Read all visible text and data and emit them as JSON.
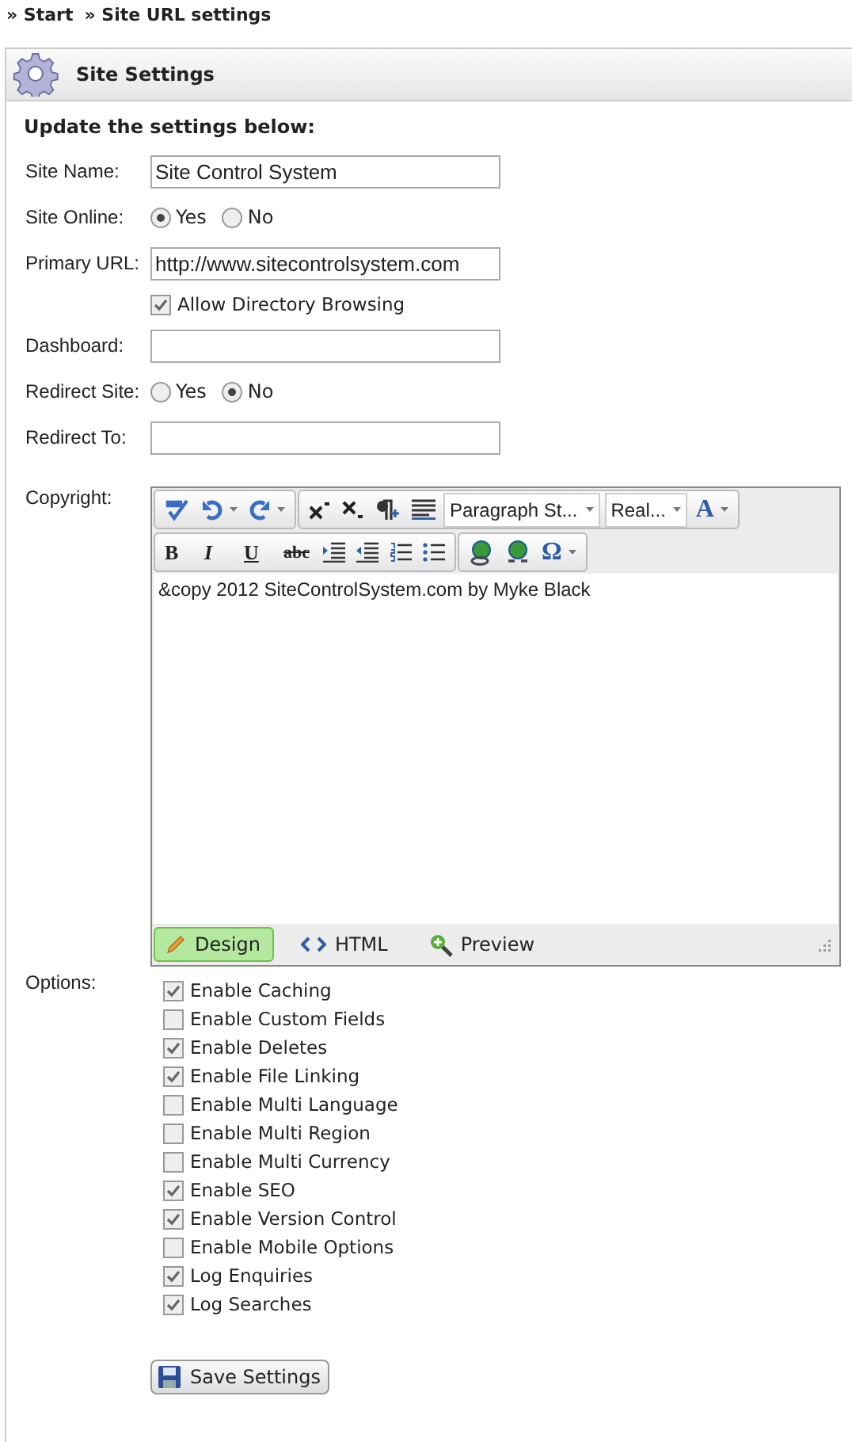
{
  "breadcrumb": [
    {
      "label": "» Start"
    },
    {
      "label": "» Site URL settings"
    }
  ],
  "panel": {
    "title": "Site Settings",
    "intro": "Update the settings below:"
  },
  "fields": [
    {
      "kind": "text",
      "label": "Site Name:",
      "value": "Site Control System"
    },
    {
      "kind": "radio",
      "label": "Site Online:",
      "options": [
        {
          "label": "Yes",
          "selected": true
        },
        {
          "label": "No",
          "selected": false
        }
      ]
    },
    {
      "kind": "text",
      "label": "Primary URL:",
      "value": "http://www.sitecontrolsystem.com"
    },
    {
      "kind": "checkbox",
      "label": "Allow Directory Browsing",
      "checked": true
    },
    {
      "kind": "text",
      "label": "Dashboard:"
    },
    {
      "kind": "radio",
      "label": "Redirect Site:",
      "options": [
        {
          "label": "Yes",
          "selected": false
        },
        {
          "label": "No",
          "selected": true
        }
      ]
    },
    {
      "kind": "text",
      "label": "Redirect To:"
    }
  ],
  "copyright": {
    "label": "Copyright:",
    "paragraph_style": "Paragraph St...",
    "font": "Real...",
    "font_color": "A",
    "format_buttons": [
      "B",
      "I",
      "U",
      "abc"
    ],
    "special_char": "Ω",
    "content": "&copy 2012 SiteControlSystem.com by Myke Black",
    "modes": [
      {
        "label": "Design",
        "selected": true
      },
      {
        "label": "HTML",
        "selected": false
      },
      {
        "label": "Preview",
        "selected": false
      }
    ]
  },
  "options": {
    "label": "Options:",
    "items": [
      {
        "label": "Enable Caching",
        "checked": true
      },
      {
        "label": "Enable Custom Fields",
        "checked": false
      },
      {
        "label": "Enable Deletes",
        "checked": true
      },
      {
        "label": "Enable File Linking",
        "checked": true
      },
      {
        "label": "Enable Multi Language",
        "checked": false
      },
      {
        "label": "Enable Multi Region",
        "checked": false
      },
      {
        "label": "Enable Multi Currency",
        "checked": false
      },
      {
        "label": "Enable SEO",
        "checked": true
      },
      {
        "label": "Enable Version Control",
        "checked": true
      },
      {
        "label": "Enable Mobile Options",
        "checked": false
      },
      {
        "label": "Log Enquiries",
        "checked": true
      },
      {
        "label": "Log Searches",
        "checked": true
      }
    ]
  },
  "save_button": {
    "label": "Save Settings"
  }
}
